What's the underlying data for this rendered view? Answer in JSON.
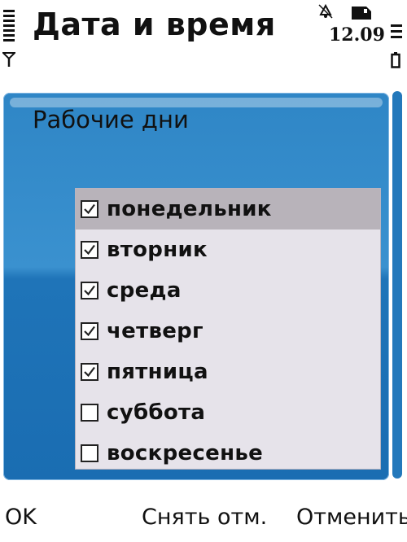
{
  "header": {
    "title": "Дата и время",
    "time": "12.09",
    "signal_icon": "signal-strength-icon",
    "antenna_icon": "antenna-icon",
    "alarm_icon": "alarm-icon",
    "sim_icon": "sim-card-icon",
    "battery_icon": "battery-icon"
  },
  "dialog": {
    "title": "Рабочие дни",
    "items": [
      {
        "label": "понедельник",
        "checked": true,
        "selected": true
      },
      {
        "label": "вторник",
        "checked": true,
        "selected": false
      },
      {
        "label": "среда",
        "checked": true,
        "selected": false
      },
      {
        "label": "четверг",
        "checked": true,
        "selected": false
      },
      {
        "label": "пятница",
        "checked": true,
        "selected": false
      },
      {
        "label": "суббота",
        "checked": false,
        "selected": false
      },
      {
        "label": "воскресенье",
        "checked": false,
        "selected": false
      }
    ]
  },
  "softkeys": {
    "left": "OK",
    "middle": "Снять отм.",
    "right": "Отменить"
  },
  "colors": {
    "panel_blue": "#2f86c6",
    "list_bg": "#e6e3ea",
    "selection": "#b8b3ba"
  }
}
